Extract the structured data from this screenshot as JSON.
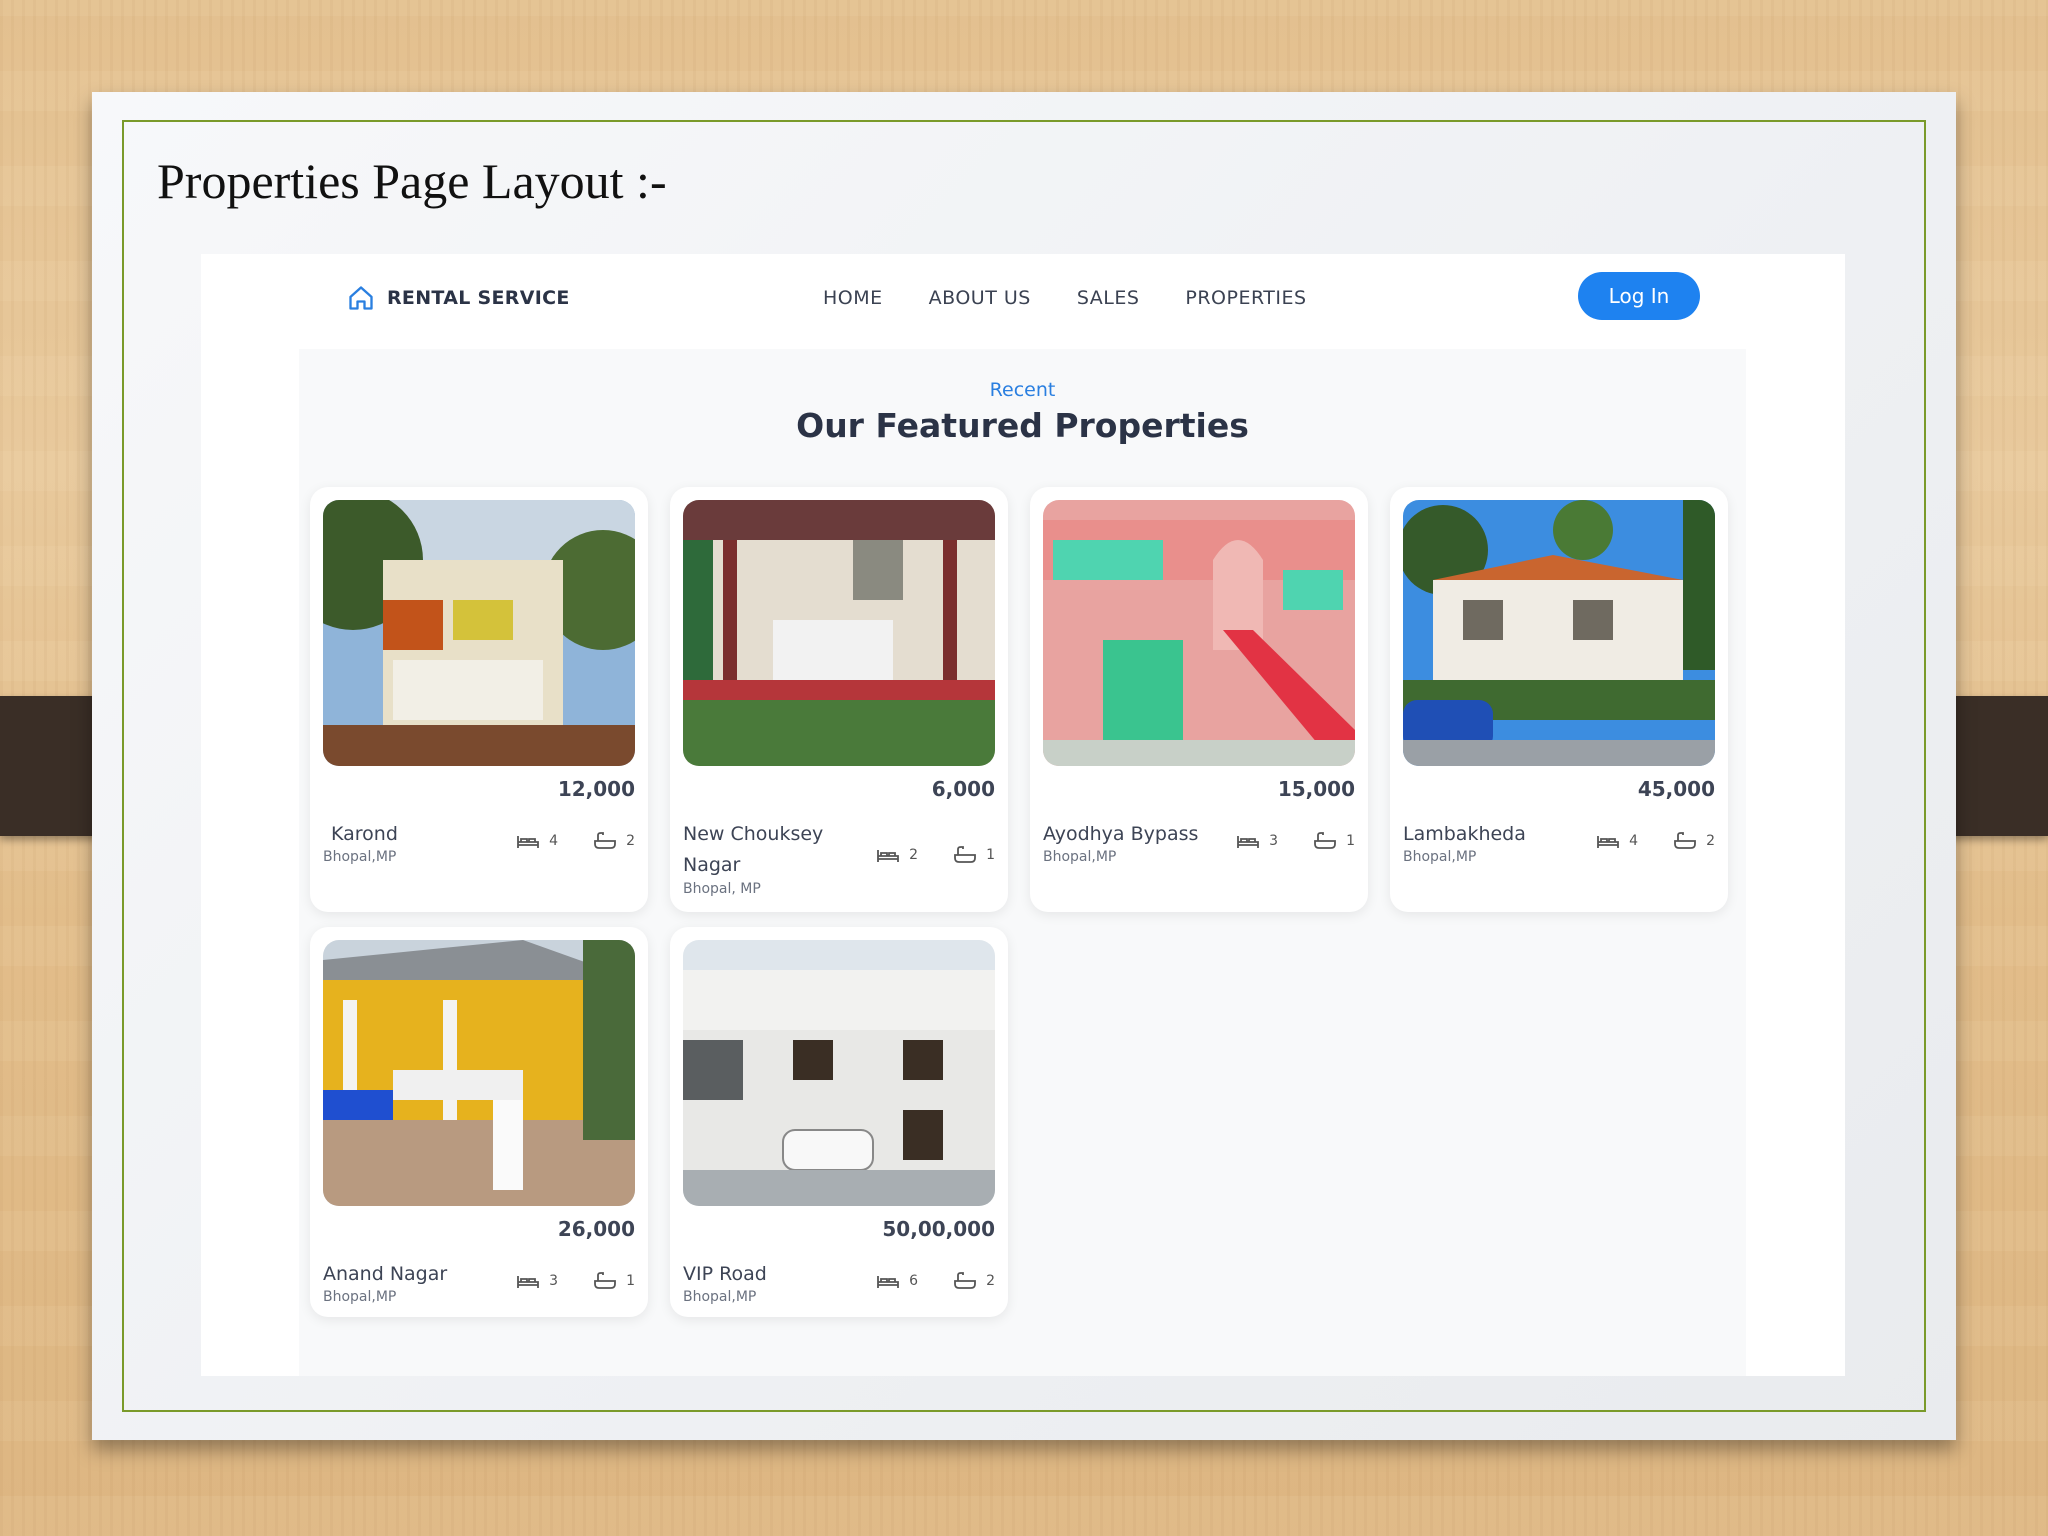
{
  "slide": {
    "title": "Properties Page Layout :-"
  },
  "nav": {
    "brand": "RENTAL SERVICE",
    "links": [
      "HOME",
      "ABOUT US",
      "SALES",
      "PROPERTIES"
    ],
    "login": "Log In"
  },
  "section": {
    "eyebrow": "Recent",
    "heading": "Our Featured Properties"
  },
  "properties": [
    {
      "price": "12,000",
      "name": "Karond",
      "location": "Bhopal,MP",
      "beds": "4",
      "baths": "2"
    },
    {
      "price": "6,000",
      "name": "New Chouksey Nagar",
      "location": "Bhopal, MP",
      "beds": "2",
      "baths": "1"
    },
    {
      "price": "15,000",
      "name": "Ayodhya Bypass",
      "location": "Bhopal,MP",
      "beds": "3",
      "baths": "1"
    },
    {
      "price": "45,000",
      "name": "Lambakheda",
      "location": "Bhopal,MP",
      "beds": "4",
      "baths": "2"
    },
    {
      "price": "26,000",
      "name": "Anand Nagar",
      "location": "Bhopal,MP",
      "beds": "3",
      "baths": "1"
    },
    {
      "price": "50,00,000",
      "name": "VIP Road",
      "location": "Bhopal,MP",
      "beds": "6",
      "baths": "2"
    }
  ],
  "colors": {
    "accent": "#1e82f0",
    "frame": "#7a9a2a",
    "heading": "#2b3346"
  },
  "icons": [
    "home-icon",
    "bed-icon",
    "bath-icon"
  ]
}
